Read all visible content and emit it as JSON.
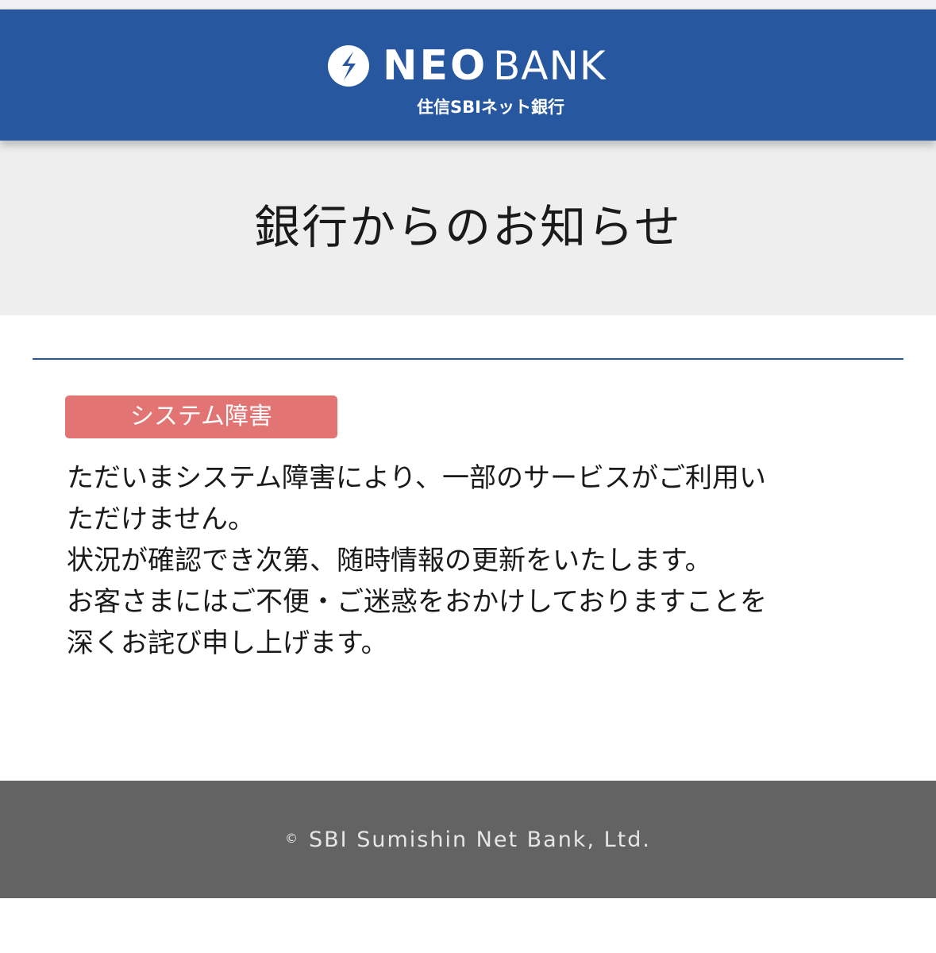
{
  "header": {
    "logo_neo": "NEO",
    "logo_bank": "BANK",
    "logo_sub": "住信SBIネット銀行",
    "logo_icon": "neobank-s-mark-icon",
    "background_color": "#26579f"
  },
  "page": {
    "title": "銀行からのお知らせ"
  },
  "notice": {
    "badge": "システム障害",
    "badge_color": "#e27573",
    "lines": [
      "ただいまシステム障害により、一部のサービスがご利用い",
      "ただけません。",
      "状況が確認でき次第、随時情報の更新をいたします。",
      "お客さまにはご不便・ご迷惑をおかけしておりますことを",
      "深くお詫び申し上げます。"
    ]
  },
  "footer": {
    "copyright_symbol": "©",
    "copyright_text": "SBI Sumishin Net Bank, Ltd."
  }
}
